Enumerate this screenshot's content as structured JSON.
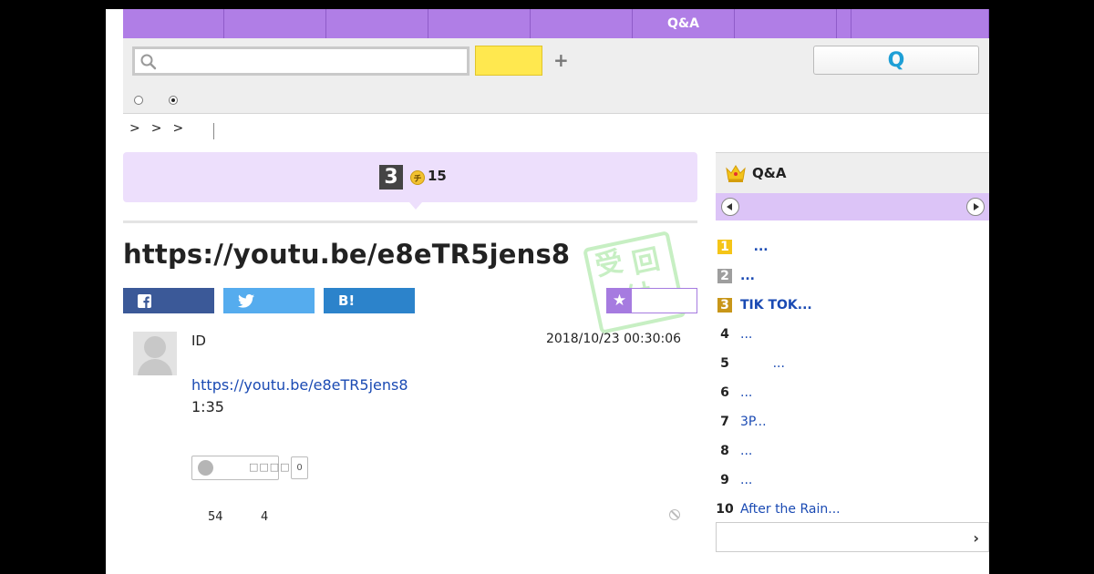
{
  "nav": {
    "tabs": [
      {
        "label": "",
        "width": 111
      },
      {
        "label": "",
        "width": 112
      },
      {
        "label": "",
        "width": 112
      },
      {
        "label": "",
        "width": 112
      },
      {
        "label": "",
        "width": 112
      },
      {
        "label": "Q&A",
        "width": 112
      },
      {
        "label": "",
        "width": 112
      },
      {
        "label": "",
        "width": 16
      },
      {
        "label": "",
        "width": 151
      }
    ]
  },
  "search": {
    "placeholder": "",
    "submit_label": "",
    "plus_label": "+",
    "q_button_label": "Q"
  },
  "breadcrumb": {
    "seps": [
      ">",
      ">",
      ">"
    ]
  },
  "question": {
    "answer_count": "3",
    "coin_symbol": "チ",
    "coins": "15",
    "title": "https://youtu.be/e8eTR5jens8",
    "stamp": [
      "受",
      "回",
      "付"
    ]
  },
  "share": {
    "facebook": "f",
    "twitter": "t",
    "hatena": "B!",
    "favorite_star": "★"
  },
  "post": {
    "user_id": "ID",
    "date": "2018/10/23  00:30:06",
    "link": "https://youtu.be/e8eTR5jens8",
    "duration": "1:35",
    "reaction_label": "□□□□",
    "reaction_count": "0",
    "stat_views": "54",
    "stat_other": "4"
  },
  "sidebar": {
    "title": "Q&A",
    "ranking": [
      {
        "rank": "1",
        "text": "   ...",
        "bold": true
      },
      {
        "rank": "2",
        "text": "...",
        "bold": true
      },
      {
        "rank": "3",
        "text": "TIK TOK...",
        "bold": true
      },
      {
        "rank": "4",
        "text": "...",
        "bold": false
      },
      {
        "rank": "5",
        "text": "        ...",
        "bold": false
      },
      {
        "rank": "6",
        "text": "...",
        "bold": false
      },
      {
        "rank": "7",
        "text": "3P...",
        "bold": false
      },
      {
        "rank": "8",
        "text": "...",
        "bold": false
      },
      {
        "rank": "9",
        "text": "...",
        "bold": false
      },
      {
        "rank": "10",
        "text": "After the Rain...",
        "bold": false
      }
    ],
    "more_chevron": "›"
  },
  "colors": {
    "nav": "#b07ee6",
    "banner": "#eddffc",
    "link": "#1a4ab3",
    "facebook": "#3b5998",
    "twitter": "#55acee",
    "hatena": "#2c83cb"
  }
}
